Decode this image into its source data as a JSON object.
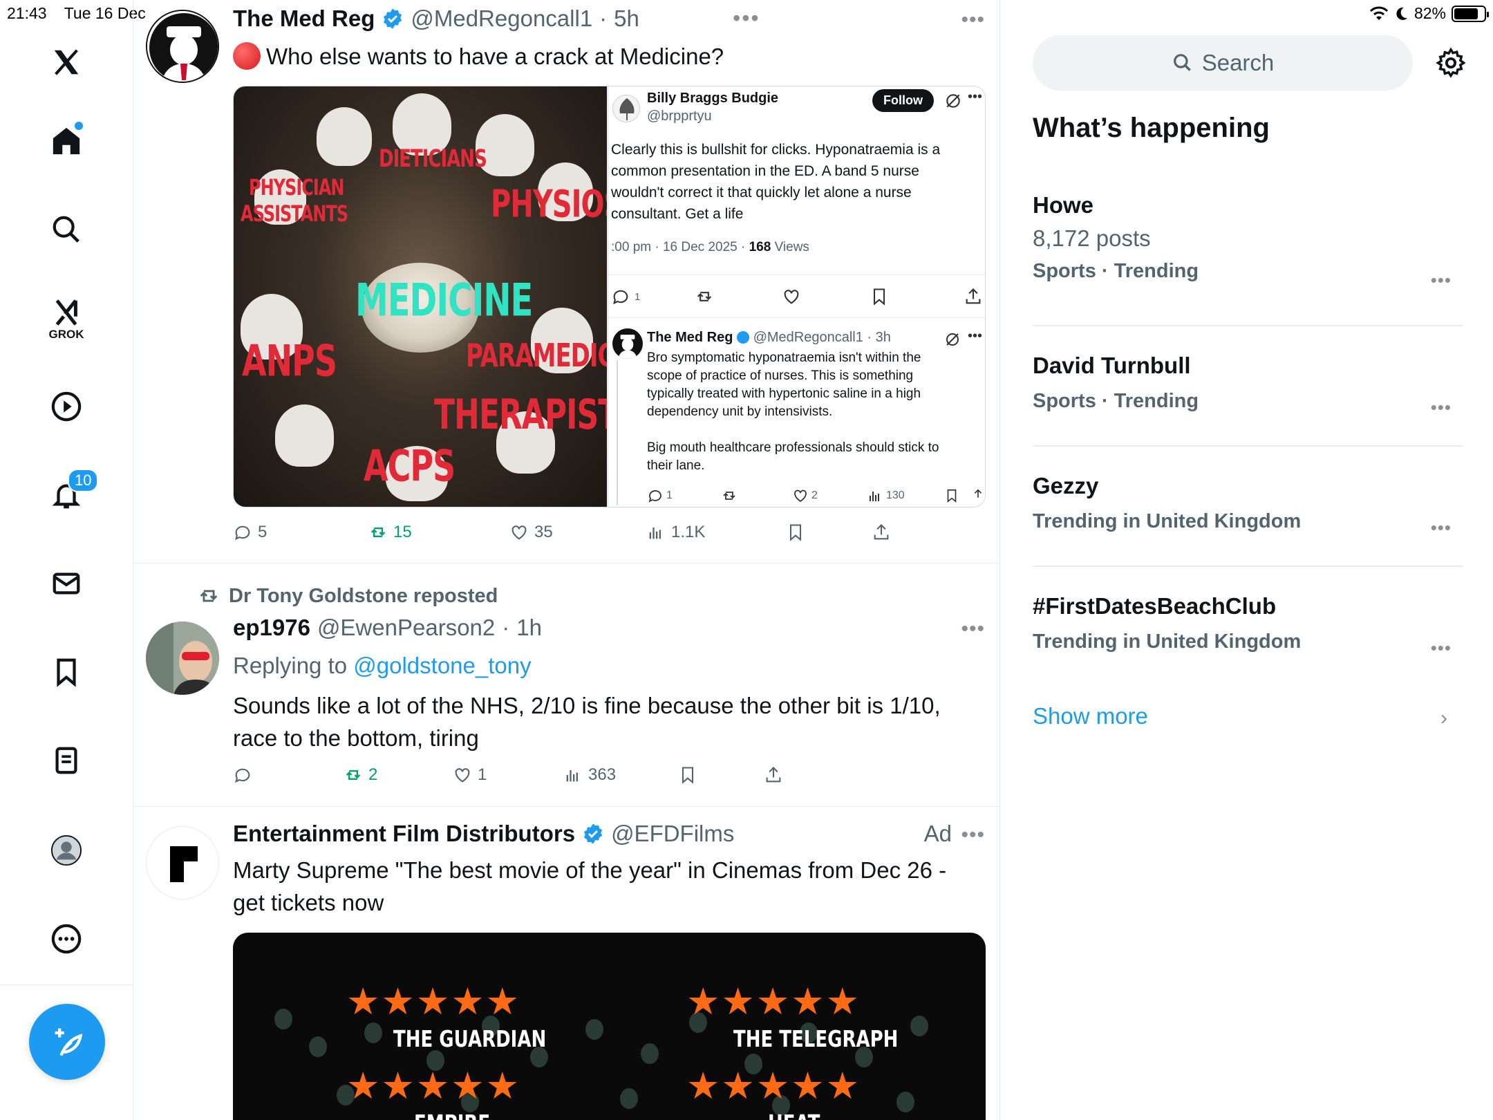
{
  "status": {
    "time": "21:43",
    "date": "Tue 16 Dec",
    "battery": "82%",
    "battery_level": 0.82
  },
  "nav": {
    "grok_label": "GROK",
    "notifications_count": "10"
  },
  "tweets": [
    {
      "name": "The Med Reg",
      "handle": "@MedRegoncall1",
      "time": "5h",
      "text": "Who else wants to have a crack at Medicine?",
      "image_labels": [
        "DIETICIANS",
        "PHYSICIAN",
        "ASSISTANTS",
        "PHYSIOS",
        "MEDICINE",
        "ANPS",
        "PARAMEDICS",
        "THERAPISTS",
        "ACPS"
      ],
      "quoted": {
        "reply": {
          "name": "Billy Braggs Budgie",
          "handle": "@brpprtyu",
          "follow_label": "Follow",
          "text_lines": [
            "Clearly this is bullshit for clicks. Hyponatraemia is a",
            "common presentation in the ED. A band 5 nurse",
            "wouldn't correct it that quickly let alone a nurse",
            "consultant. Get a life"
          ],
          "meta": ":00 pm · 16 Dec 2025 · ",
          "views_count": "168",
          "views_label": " Views",
          "reply_count": "1"
        },
        "original": {
          "name": "The Med Reg",
          "handle": "@MedRegoncall1 · 3h",
          "text_lines": [
            "Bro symptomatic hyponatraemia isn't within the",
            "scope of practice of nurses. This is something",
            "typically treated with hypertonic saline in a high",
            "dependency unit by intensivists.",
            "",
            "Big mouth healthcare professionals should stick to",
            "their lane."
          ],
          "replies": "1",
          "likes": "2",
          "views": "130"
        }
      },
      "stats": {
        "replies": "5",
        "reposts": "15",
        "likes": "35",
        "views": "1.1K"
      }
    },
    {
      "reposted_by": "Dr Tony Goldstone reposted",
      "name": "ep1976",
      "handle": "@EwenPearson2",
      "time": "1h",
      "replying_prefix": "Replying to ",
      "replying_to": "@goldstone_tony",
      "text": "Sounds like a lot of the NHS, 2/10 is fine because the other bit is 1/10, race to the bottom, tiring",
      "stats": {
        "replies": "",
        "reposts": "2",
        "likes": "1",
        "views": "363"
      }
    },
    {
      "name": "Entertainment Film Distributors",
      "handle": "@EFDFilms",
      "ad_label": "Ad",
      "text": "Marty Supreme \"The best movie of the year\" in Cinemas from Dec 26 - get tickets now",
      "image_labels": [
        "THE GUARDIAN",
        "THE TELEGRAPH",
        "EMPIRE",
        "HEAT"
      ],
      "stars": "★★★★★"
    }
  ],
  "sidebar": {
    "search_placeholder": "Search",
    "title": "What’s happening",
    "trends": [
      {
        "name": "Howe",
        "count": "8,172 posts",
        "context": "Sports · Trending"
      },
      {
        "name": "David Turnbull",
        "count": "",
        "context": "Sports · Trending"
      },
      {
        "name": "Gezzy",
        "count": "",
        "context": "Trending in United Kingdom"
      },
      {
        "name": "#FirstDatesBeachClub",
        "count": "",
        "context": "Trending in United Kingdom"
      }
    ],
    "show_more": "Show more"
  },
  "colors": {
    "accent": "#1d9bf0",
    "repost_green": "#00a070",
    "text": "#0f1419",
    "muted": "#536471"
  }
}
